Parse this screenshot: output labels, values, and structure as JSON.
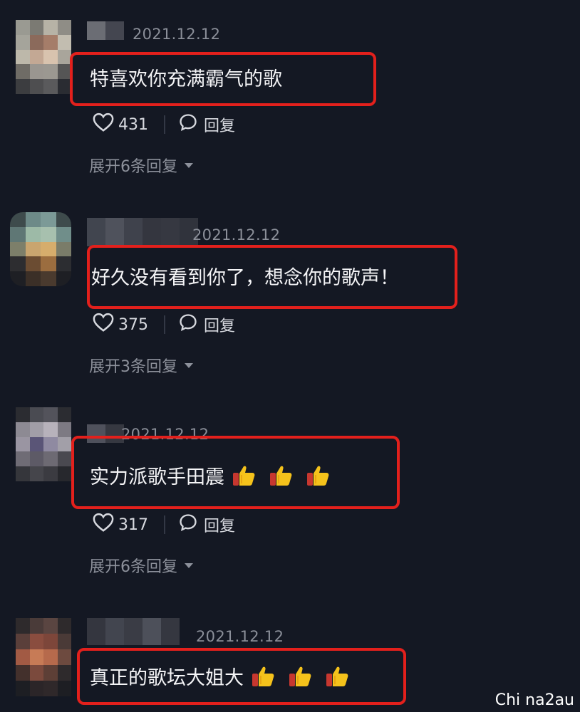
{
  "comments": [
    {
      "date": "2021.12.12",
      "text": "特喜欢你充满霸气的歌",
      "likes": "431",
      "reply_label": "回复",
      "expand": "展开6条回复",
      "thumbs": 0
    },
    {
      "date": "2021.12.12",
      "text": "好久没有看到你了，想念你的歌声！",
      "likes": "375",
      "reply_label": "回复",
      "expand": "展开3条回复",
      "thumbs": 0
    },
    {
      "date": "2021.12.12",
      "text": "实力派歌手田震",
      "likes": "317",
      "reply_label": "回复",
      "expand": "展开6条回复",
      "thumbs": 3
    },
    {
      "date": "2021.12.12",
      "text": "真正的歌坛大姐大",
      "thumbs": 3
    }
  ],
  "watermark": "Chi na2au",
  "colors": {
    "background": "#141823",
    "highlight_box": "#e3201c",
    "thumb": "#f5c21b"
  }
}
